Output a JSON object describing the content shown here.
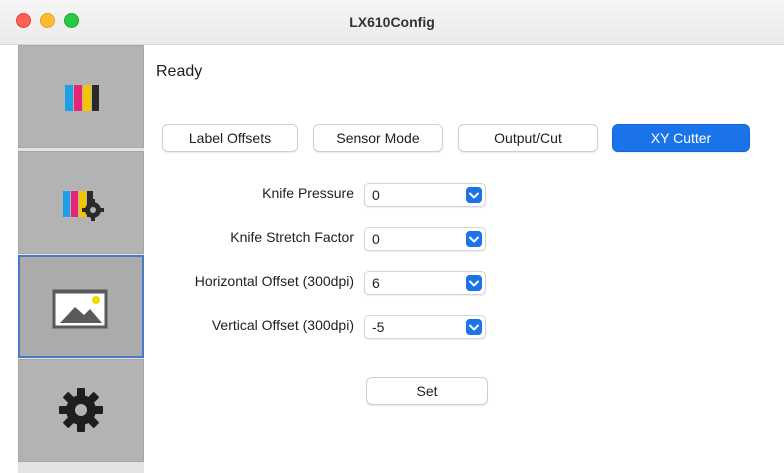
{
  "window": {
    "title": "LX610Config"
  },
  "sidebar": {
    "items": [
      {
        "icon": "color-bars-icon",
        "active": false
      },
      {
        "icon": "color-bars-settings-icon",
        "active": false
      },
      {
        "icon": "image-picture-icon",
        "active": true
      },
      {
        "icon": "gear-icon",
        "active": false
      }
    ]
  },
  "status": {
    "text": "Ready"
  },
  "tabs": [
    {
      "label": "Label Offsets",
      "active": false
    },
    {
      "label": "Sensor Mode",
      "active": false
    },
    {
      "label": "Output/Cut",
      "active": false
    },
    {
      "label": "XY Cutter",
      "active": true
    }
  ],
  "form": {
    "knife_pressure": {
      "label": "Knife Pressure",
      "value": "0"
    },
    "knife_stretch": {
      "label": "Knife Stretch Factor",
      "value": "0"
    },
    "horizontal_offset": {
      "label": "Horizontal Offset (300dpi)",
      "value": "6"
    },
    "vertical_offset": {
      "label": "Vertical Offset (300dpi)",
      "value": "-5"
    }
  },
  "actions": {
    "set_label": "Set"
  },
  "colors": {
    "accent": "#1a73e8",
    "sidebar_bg": "#b3b3b3",
    "sidebar_active_border": "#4a78c8"
  }
}
